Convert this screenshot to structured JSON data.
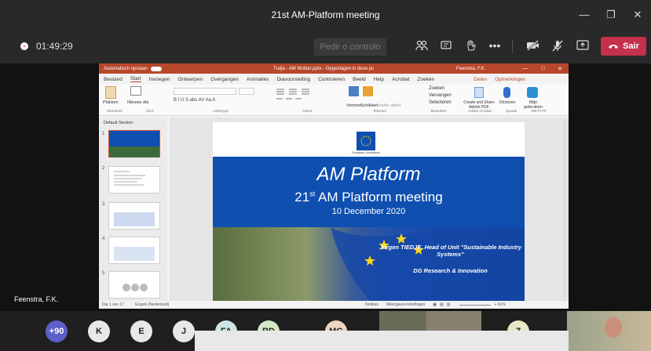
{
  "window": {
    "title": "21st  AM-Platform meeting",
    "minimize": "—",
    "maximize": "❐",
    "close": "✕"
  },
  "call": {
    "timer": "01:49:29",
    "request_control": "Pedir o controlo",
    "leave": "Sair",
    "more": "•••"
  },
  "ppt": {
    "autosave": "Automatisch opslaan",
    "file_title": "Tudja - AM Motion.pptx - Opgeslagen in deze pc",
    "user": "Feenstra, F.K.",
    "tabs": [
      "Bestand",
      "Start",
      "Invoegen",
      "Ontwerpen",
      "Overgangen",
      "Animaties",
      "Diavoorstelling",
      "Controleren",
      "Beeld",
      "Help",
      "Acrobat",
      "Zoeken"
    ],
    "share": "Delen",
    "comments": "Opmerkingen",
    "groups": [
      "Klembord",
      "Dia's",
      "Lettertype",
      "Alinea",
      "Tekenen",
      "Bewerken",
      "Adobe Acrobat",
      "Spraak",
      "INKTFYR"
    ],
    "ribbon": {
      "paste": "Plakken",
      "new_slide": "Nieuwe dia",
      "shapes": "Vormen",
      "arrange": "Schikken",
      "styles": "Snelle stijlen",
      "find": "Zoeken",
      "replace": "Vervangen",
      "select": "Selecteren",
      "create_pdf": "Create and Share Adobe PDF",
      "dictate": "Dicteren",
      "mijn": "Mijn gebruiken"
    },
    "section": "Default Section",
    "status_slide": "Dia 1 van 17",
    "status_lang": "Engels (Nederland)",
    "status_notes": "Notities",
    "status_display": "Weergave-instellingen",
    "status_zoom": "+ 61%",
    "slide": {
      "org": "European Commission",
      "title": "AM Platform",
      "subtitle_pre": "21",
      "subtitle_sup": "st",
      "subtitle_post": " AM Platform meeting",
      "date": "10 December 2020",
      "speaker": "Jürgen TIEDJE, Head of Unit \"Sustainable Industry Systems\"",
      "dg": "DG Research & Innovation"
    },
    "thumb_numbers": [
      "1",
      "2",
      "3",
      "4",
      "5"
    ]
  },
  "participants": {
    "presenter_name": "Feenstra, F.K.",
    "overflow": "+90",
    "initials": [
      "K",
      "E",
      "J",
      "FA",
      "RD",
      "MG",
      "Z"
    ]
  },
  "colors": {
    "leave": "#c4314b",
    "slide_blue": "#0e4fb0",
    "ppt_accent": "#b7472a"
  }
}
